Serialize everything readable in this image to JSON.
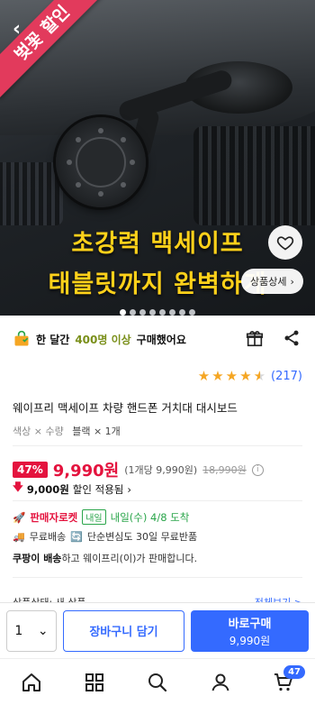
{
  "hero": {
    "ribbon": "벚꽃 할인",
    "promo_line1": "초강력 맥세이프",
    "promo_line2": "태블릿까지 완벽하게",
    "detail_button": "상품상세",
    "dots_count": 8,
    "active_dot": 0
  },
  "buyers": {
    "prefix": "한 달간",
    "count": "400명 이상",
    "suffix": "구매했어요"
  },
  "rating": {
    "stars": 4.5,
    "count": "(217)"
  },
  "product": {
    "title": "웨이프리 맥세이프 차량 핸드폰 거치대 대시보드",
    "option_label": "색상 × 수량",
    "option_value": "블랙 × 1개"
  },
  "price": {
    "discount_pct": "47%",
    "sale_price": "9,990원",
    "unit_price": "(1개당 9,990원)",
    "original_price": "18,990원",
    "discount_amount": "9,000원",
    "discount_text": "할인 적용됨"
  },
  "delivery": {
    "rocket_label": "판매자로켓",
    "tomorrow_badge": "내일",
    "arrival": "내일(수) 4/8 도착",
    "free_shipping": "무료배송",
    "free_return": "단순변심도 30일 무료반품",
    "seller_bold": "쿠팡이 배송",
    "seller_rest": "하고 웨이프리(이)가 판매합니다."
  },
  "condition": {
    "label": "상품상태: 새 상품",
    "link": "전체보기 >"
  },
  "action_bar": {
    "quantity": "1",
    "cart_button": "장바구니 담기",
    "buy_button": "바로구매",
    "buy_price": "9,990원"
  },
  "nav": {
    "cart_badge": "47"
  },
  "colors": {
    "accent_blue": "#346aff",
    "sale_red": "#e4133e",
    "promo_yellow": "#ffd11a",
    "ribbon_pink": "#e23a5c",
    "rocket_green": "#2aa54a"
  }
}
